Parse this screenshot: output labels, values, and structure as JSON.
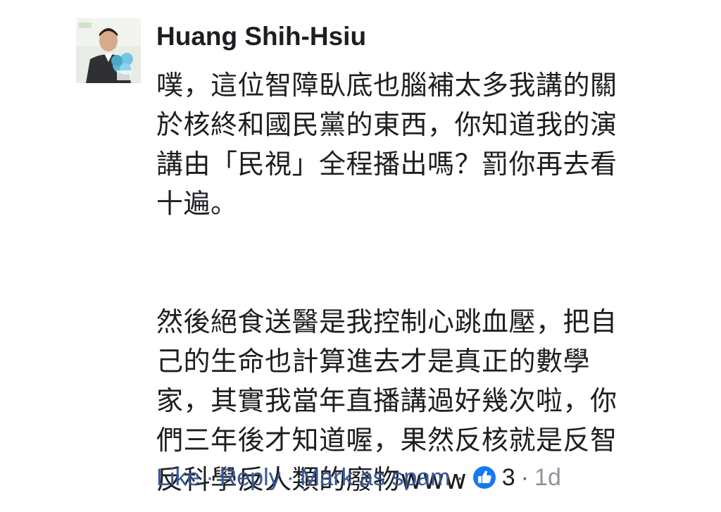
{
  "comment": {
    "author": "Huang Shih-Hsiu",
    "paragraphs": [
      {
        "lines": [
          "噗，這位智障臥底也腦補太多我講的關",
          "於核終和國民黨的東西，你知道我的演",
          "講由「民視」全程播出嗎？罰你再去看",
          "十遍。"
        ]
      },
      {
        "lines": [
          "然後絕食送醫是我控制心跳血壓，把自",
          "己的生命也計算進去才是真正的數學",
          "家，其實我當年直播講過好幾次啦，你",
          "們三年後才知道喔，果然反核就是反智",
          "反科學反人類的廢物www"
        ]
      }
    ],
    "actions": {
      "like_label": "Like",
      "reply_label": "Reply",
      "spam_label": "Mark as spam",
      "separator": "·",
      "reaction_count": "3",
      "timestamp": "1d",
      "reaction_icon": "thumbs-up-icon"
    },
    "colors": {
      "link": "#385898",
      "text": "#1c1e21",
      "muted": "#8d949e",
      "like_badge": "#1877f2"
    }
  }
}
